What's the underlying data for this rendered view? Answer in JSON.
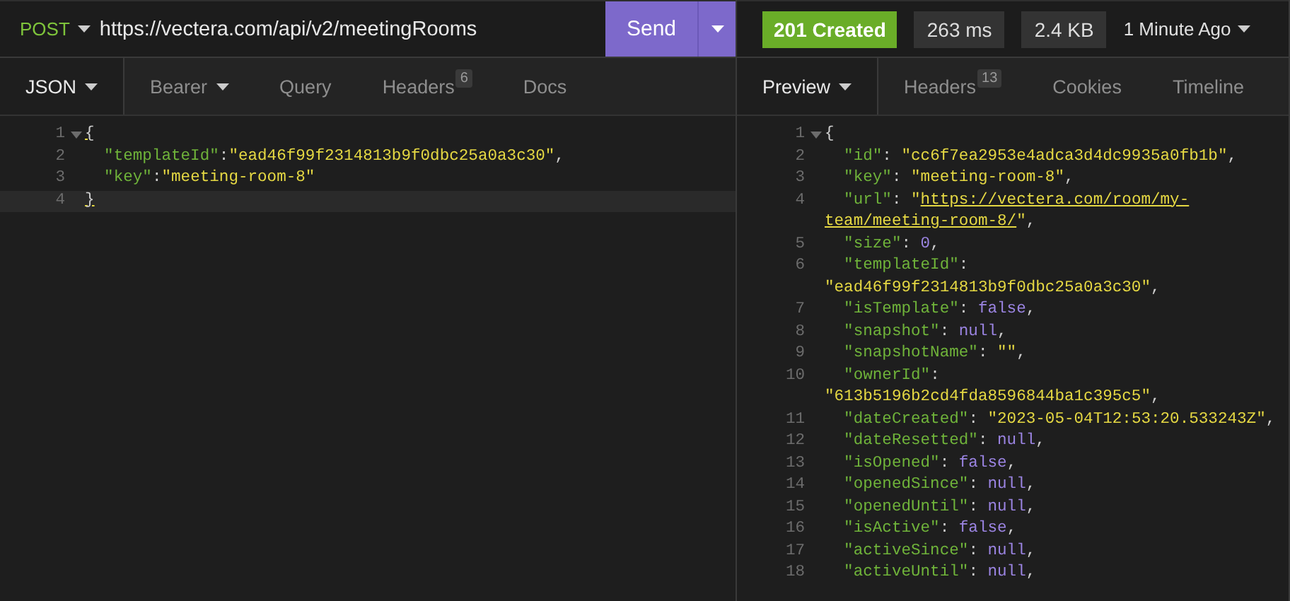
{
  "request": {
    "method": "POST",
    "url": "https://vectera.com/api/v2/meetingRooms",
    "send_label": "Send",
    "tabs": [
      {
        "label": "JSON",
        "selected": true,
        "dropdown": true
      },
      {
        "label": "Bearer",
        "selected": false,
        "dropdown": true
      },
      {
        "label": "Query",
        "selected": false,
        "dropdown": false
      },
      {
        "label": "Headers",
        "selected": false,
        "dropdown": false,
        "badge": "6"
      },
      {
        "label": "Docs",
        "selected": false,
        "dropdown": false
      }
    ],
    "editor": [
      {
        "number": "1",
        "foldable": true,
        "active": false,
        "tokens": [
          {
            "kind": "brace",
            "text": "{"
          }
        ]
      },
      {
        "number": "2",
        "foldable": false,
        "active": false,
        "tokens": [
          {
            "kind": "key",
            "text": "\"templateId\""
          },
          {
            "kind": "punct",
            "text": ":"
          },
          {
            "kind": "str",
            "text": "\"ead46f99f2314813b9f0dbc25a0a3c30\""
          },
          {
            "kind": "punct",
            "text": ","
          }
        ]
      },
      {
        "number": "3",
        "foldable": false,
        "active": false,
        "tokens": [
          {
            "kind": "key",
            "text": "\"key\""
          },
          {
            "kind": "punct",
            "text": ":"
          },
          {
            "kind": "str",
            "text": "\"meeting-room-8\""
          }
        ]
      },
      {
        "number": "4",
        "foldable": false,
        "active": true,
        "tokens": [
          {
            "kind": "brace",
            "text": "}"
          }
        ]
      }
    ]
  },
  "response": {
    "status": "201 Created",
    "time": "263 ms",
    "size": "2.4 KB",
    "age": "1 Minute Ago",
    "tabs": [
      {
        "label": "Preview",
        "selected": true,
        "dropdown": true
      },
      {
        "label": "Headers",
        "selected": false,
        "dropdown": false,
        "badge": "13"
      },
      {
        "label": "Cookies",
        "selected": false,
        "dropdown": false
      },
      {
        "label": "Timeline",
        "selected": false,
        "dropdown": false
      }
    ],
    "body": [
      {
        "number": "1",
        "foldable": true,
        "active": false,
        "tokens": [
          {
            "kind": "punct",
            "text": "{"
          }
        ]
      },
      {
        "number": "2",
        "foldable": false,
        "active": false,
        "tokens": [
          {
            "kind": "key",
            "text": "\"id\""
          },
          {
            "kind": "punct",
            "text": ": "
          },
          {
            "kind": "str",
            "text": "\"cc6f7ea2953e4adca3d4dc9935a0fb1b\""
          },
          {
            "kind": "punct",
            "text": ","
          }
        ]
      },
      {
        "number": "3",
        "foldable": false,
        "active": false,
        "tokens": [
          {
            "kind": "key",
            "text": "\"key\""
          },
          {
            "kind": "punct",
            "text": ": "
          },
          {
            "kind": "str",
            "text": "\"meeting-room-8\""
          },
          {
            "kind": "punct",
            "text": ","
          }
        ]
      },
      {
        "number": "4",
        "foldable": false,
        "active": false,
        "tokens": [
          {
            "kind": "key",
            "text": "\"url\""
          },
          {
            "kind": "punct",
            "text": ": "
          },
          {
            "kind": "str",
            "text": "\""
          },
          {
            "kind": "link",
            "text": "https://vectera.com/room/my-"
          },
          {
            "kind": "link",
            "text": "team/meeting-room-8/"
          },
          {
            "kind": "str",
            "text": "\""
          },
          {
            "kind": "punct",
            "text": ","
          }
        ]
      },
      {
        "number": "5",
        "foldable": false,
        "active": false,
        "tokens": [
          {
            "kind": "key",
            "text": "\"size\""
          },
          {
            "kind": "punct",
            "text": ": "
          },
          {
            "kind": "num",
            "text": "0"
          },
          {
            "kind": "punct",
            "text": ","
          }
        ]
      },
      {
        "number": "6",
        "foldable": false,
        "active": false,
        "tokens": [
          {
            "kind": "key",
            "text": "\"templateId\""
          },
          {
            "kind": "punct",
            "text": ": "
          },
          {
            "kind": "str",
            "text": "\"ead46f99f2314813b9f0dbc25a0a3c30\""
          },
          {
            "kind": "punct",
            "text": ","
          }
        ]
      },
      {
        "number": "7",
        "foldable": false,
        "active": false,
        "tokens": [
          {
            "kind": "key",
            "text": "\"isTemplate\""
          },
          {
            "kind": "punct",
            "text": ": "
          },
          {
            "kind": "num",
            "text": "false"
          },
          {
            "kind": "punct",
            "text": ","
          }
        ]
      },
      {
        "number": "8",
        "foldable": false,
        "active": false,
        "tokens": [
          {
            "kind": "key",
            "text": "\"snapshot\""
          },
          {
            "kind": "punct",
            "text": ": "
          },
          {
            "kind": "num",
            "text": "null"
          },
          {
            "kind": "punct",
            "text": ","
          }
        ]
      },
      {
        "number": "9",
        "foldable": false,
        "active": false,
        "tokens": [
          {
            "kind": "key",
            "text": "\"snapshotName\""
          },
          {
            "kind": "punct",
            "text": ": "
          },
          {
            "kind": "str",
            "text": "\"\""
          },
          {
            "kind": "punct",
            "text": ","
          }
        ]
      },
      {
        "number": "10",
        "foldable": false,
        "active": false,
        "tokens": [
          {
            "kind": "key",
            "text": "\"ownerId\""
          },
          {
            "kind": "punct",
            "text": ": "
          },
          {
            "kind": "str",
            "text": "\"613b5196b2cd4fda8596844ba1c395c5\""
          },
          {
            "kind": "punct",
            "text": ","
          }
        ]
      },
      {
        "number": "11",
        "foldable": false,
        "active": false,
        "tokens": [
          {
            "kind": "key",
            "text": "\"dateCreated\""
          },
          {
            "kind": "punct",
            "text": ": "
          },
          {
            "kind": "str",
            "text": "\"2023-05-04T12:53:20.533243Z\""
          },
          {
            "kind": "punct",
            "text": ","
          }
        ]
      },
      {
        "number": "12",
        "foldable": false,
        "active": false,
        "tokens": [
          {
            "kind": "key",
            "text": "\"dateResetted\""
          },
          {
            "kind": "punct",
            "text": ": "
          },
          {
            "kind": "num",
            "text": "null"
          },
          {
            "kind": "punct",
            "text": ","
          }
        ]
      },
      {
        "number": "13",
        "foldable": false,
        "active": false,
        "tokens": [
          {
            "kind": "key",
            "text": "\"isOpened\""
          },
          {
            "kind": "punct",
            "text": ": "
          },
          {
            "kind": "num",
            "text": "false"
          },
          {
            "kind": "punct",
            "text": ","
          }
        ]
      },
      {
        "number": "14",
        "foldable": false,
        "active": false,
        "tokens": [
          {
            "kind": "key",
            "text": "\"openedSince\""
          },
          {
            "kind": "punct",
            "text": ": "
          },
          {
            "kind": "num",
            "text": "null"
          },
          {
            "kind": "punct",
            "text": ","
          }
        ]
      },
      {
        "number": "15",
        "foldable": false,
        "active": false,
        "tokens": [
          {
            "kind": "key",
            "text": "\"openedUntil\""
          },
          {
            "kind": "punct",
            "text": ": "
          },
          {
            "kind": "num",
            "text": "null"
          },
          {
            "kind": "punct",
            "text": ","
          }
        ]
      },
      {
        "number": "16",
        "foldable": false,
        "active": false,
        "tokens": [
          {
            "kind": "key",
            "text": "\"isActive\""
          },
          {
            "kind": "punct",
            "text": ": "
          },
          {
            "kind": "num",
            "text": "false"
          },
          {
            "kind": "punct",
            "text": ","
          }
        ]
      },
      {
        "number": "17",
        "foldable": false,
        "active": false,
        "tokens": [
          {
            "kind": "key",
            "text": "\"activeSince\""
          },
          {
            "kind": "punct",
            "text": ": "
          },
          {
            "kind": "num",
            "text": "null"
          },
          {
            "kind": "punct",
            "text": ","
          }
        ]
      },
      {
        "number": "18",
        "foldable": false,
        "active": false,
        "tokens": [
          {
            "kind": "key",
            "text": "\"activeUntil\""
          },
          {
            "kind": "punct",
            "text": ": "
          },
          {
            "kind": "num",
            "text": "null"
          },
          {
            "kind": "punct",
            "text": ","
          }
        ]
      }
    ]
  }
}
